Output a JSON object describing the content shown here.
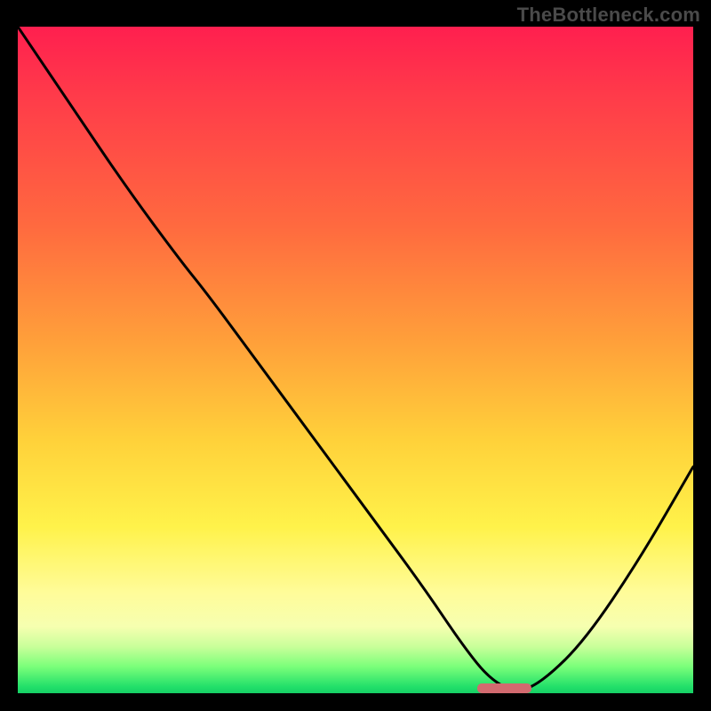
{
  "watermark": "TheBottleneck.com",
  "colors": {
    "curve": "#000000",
    "marker": "#d26a6f",
    "background_black": "#000000"
  },
  "chart_data": {
    "type": "line",
    "title": "",
    "xlabel": "",
    "ylabel": "",
    "xlim": [
      0,
      100
    ],
    "ylim": [
      0,
      100
    ],
    "grid": false,
    "legend": false,
    "description": "Bottleneck-style V-shaped curve over a vertical red→green gradient. Minimum (optimal point) marked by a small rounded pill near the bottom.",
    "series": [
      {
        "name": "bottleneck_curve",
        "x": [
          0,
          8,
          16,
          24,
          28,
          36,
          44,
          52,
          60,
          66,
          70,
          74,
          78,
          84,
          92,
          100
        ],
        "y": [
          100,
          88,
          76,
          65,
          60,
          49,
          38,
          27,
          16,
          7,
          2,
          0,
          2,
          8,
          20,
          34
        ]
      }
    ],
    "marker": {
      "x_center": 72,
      "y": 0,
      "width_pct": 8
    },
    "gradient_stops": [
      {
        "pct": 0,
        "color": "#ff1f4f"
      },
      {
        "pct": 30,
        "color": "#ff6a3f"
      },
      {
        "pct": 62,
        "color": "#ffd13a"
      },
      {
        "pct": 85,
        "color": "#fffc9a"
      },
      {
        "pct": 100,
        "color": "#15d065"
      }
    ]
  }
}
